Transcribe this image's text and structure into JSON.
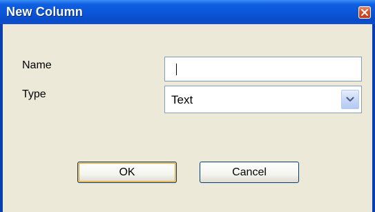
{
  "window": {
    "title": "New Column"
  },
  "form": {
    "name_label": "Name",
    "name_value": "",
    "type_label": "Type",
    "type_value": "Text"
  },
  "buttons": {
    "ok_label": "OK",
    "cancel_label": "Cancel"
  },
  "icons": {
    "close": "close-icon",
    "dropdown": "chevron-down-icon"
  },
  "colors": {
    "titlebar": "#0b55d8",
    "close_button": "#d5512c",
    "dialog_background": "#ece9d8"
  }
}
